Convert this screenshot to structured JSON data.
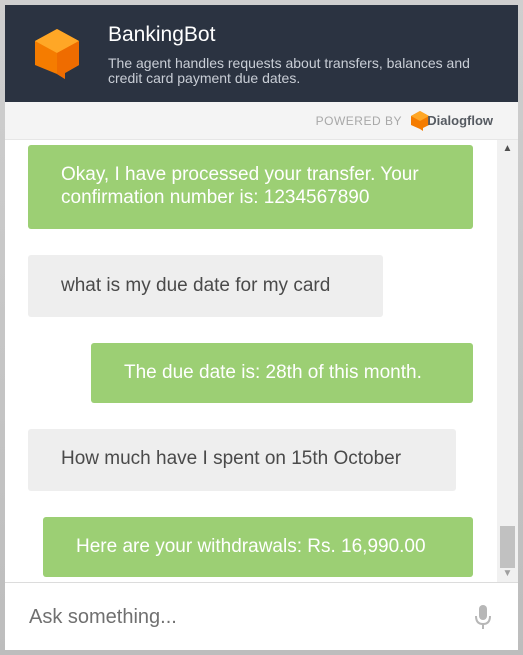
{
  "header": {
    "bot_name": "BankingBot",
    "description": "The agent handles requests about transfers, balances and credit card payment due dates."
  },
  "powered": {
    "label": "POWERED BY",
    "brand": "Dialogflow"
  },
  "messages": [
    {
      "sender": "bot",
      "text": "Okay, I have processed your transfer. Your confirmation number is: 1234567890"
    },
    {
      "sender": "user",
      "text": "what is my due date for my card"
    },
    {
      "sender": "bot",
      "text": "The due date is: 28th of this month."
    },
    {
      "sender": "user",
      "text": "How much have I spent on 15th October"
    },
    {
      "sender": "bot",
      "text": "Here are your withdrawals: Rs. 16,990.00"
    }
  ],
  "composer": {
    "placeholder": "Ask something..."
  },
  "icons": {
    "logo": "dialogflow-logo-icon",
    "mic": "microphone-icon",
    "scroll_up": "scroll-up-arrow-icon",
    "scroll_down": "scroll-down-arrow-icon"
  },
  "colors": {
    "header_bg": "#2b3341",
    "bot_bubble": "#9ccf74",
    "user_bubble": "#eeeeee",
    "logo_orange": "#f57c00"
  }
}
